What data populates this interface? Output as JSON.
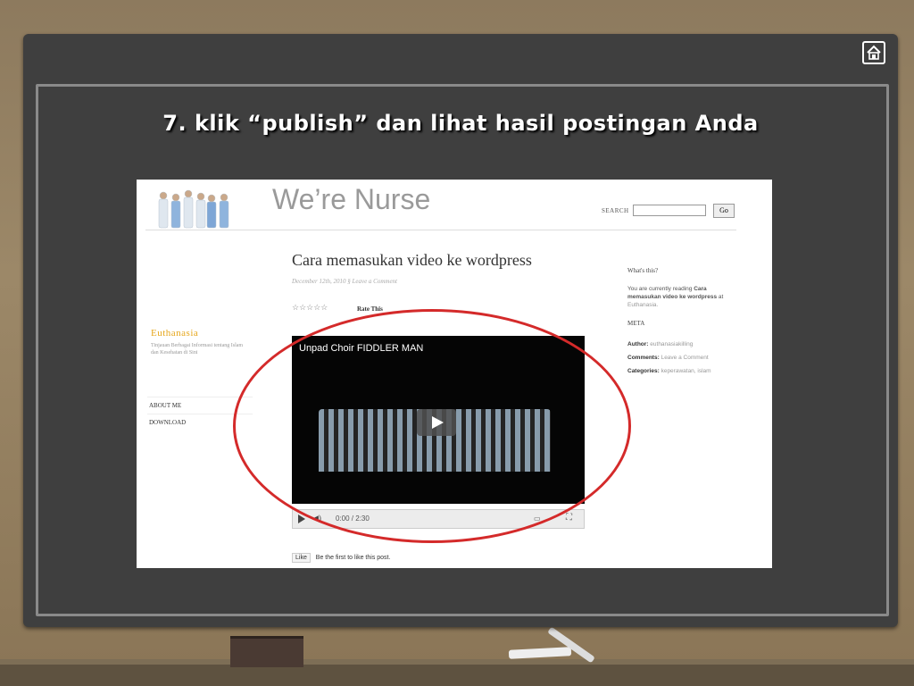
{
  "slide": {
    "title": "7. klik “publish” dan lihat hasil postingan Anda"
  },
  "icons": {
    "home": "home-icon"
  },
  "blog": {
    "site_title": "We’re Nurse",
    "search": {
      "label": "SEARCH",
      "button": "Go",
      "value": ""
    },
    "post": {
      "title": "Cara memasukan video ke wordpress",
      "meta": "December 12th, 2010 § Leave a Comment",
      "stars": "☆☆☆☆☆",
      "rate_label": "Rate This"
    },
    "video": {
      "title": "Unpad Choir FIDDLER MAN",
      "time": "0:00 / 2:30"
    },
    "like": {
      "button": "Like",
      "text": "Be the first to like this post."
    },
    "left_sidebar": {
      "title": "Euthanasia",
      "description": "Tinjauan Berbagai Informasi tentang Islam dan Kesehatan di Sini",
      "nav": [
        "ABOUT ME",
        "DOWNLOAD"
      ]
    },
    "right_sidebar": {
      "heading": "What's this?",
      "text_intro": "You are currently reading",
      "text_post": "Cara memasukan video ke wordpress",
      "text_at": "at",
      "text_site": "Euthanasia.",
      "meta_heading": "META",
      "author_label": "Author:",
      "author_value": "euthanasiakilling",
      "comments_label": "Comments:",
      "comments_value": "Leave a Comment",
      "categories_label": "Categories:",
      "categories_value": "keperawatan, islam"
    }
  },
  "colors": {
    "highlight_circle": "#d42a2a",
    "board": "#3f3f3f"
  }
}
